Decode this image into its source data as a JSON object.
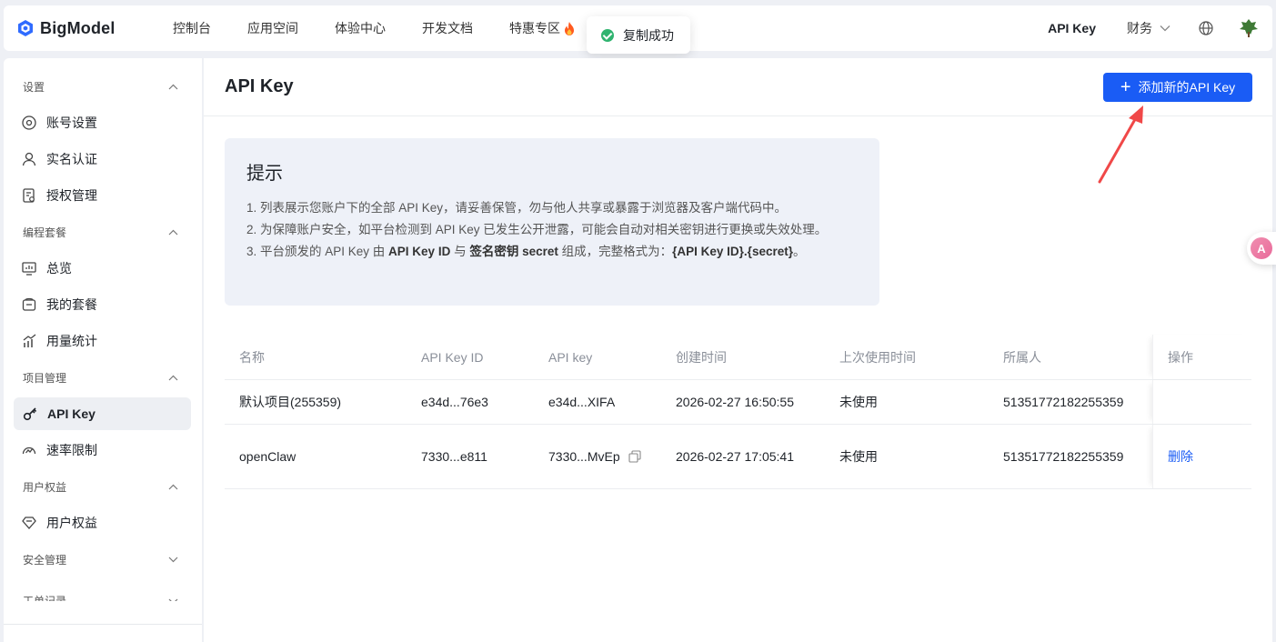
{
  "brand": {
    "name": "BigModel"
  },
  "topnav": {
    "items": [
      "控制台",
      "应用空间",
      "体验中心",
      "开发文档",
      "特惠专区"
    ],
    "apikey": "API Key",
    "finance": "财务"
  },
  "toast": {
    "text": "复制成功"
  },
  "sidebar": {
    "groups": [
      {
        "label": "设置",
        "items": [
          "账号设置",
          "实名认证",
          "授权管理"
        ]
      },
      {
        "label": "编程套餐",
        "items": [
          "总览",
          "我的套餐",
          "用量统计"
        ]
      },
      {
        "label": "项目管理",
        "items": [
          "API Key",
          "速率限制"
        ]
      },
      {
        "label": "用户权益",
        "items": [
          "用户权益"
        ]
      },
      {
        "label": "安全管理",
        "items": []
      },
      {
        "label": "工单记录",
        "items": []
      }
    ]
  },
  "main": {
    "title": "API Key",
    "add_button": "添加新的API Key"
  },
  "tip": {
    "title": "提示",
    "line1": "1. 列表展示您账户下的全部 API Key，请妥善保管，勿与他人共享或暴露于浏览器及客户端代码中。",
    "line2": "2. 为保障账户安全，如平台检测到 API Key 已发生公开泄露，可能会自动对相关密钥进行更换或失效处理。",
    "line3_a": "3. 平台颁发的 API Key 由 ",
    "line3_b": "API Key ID",
    "line3_c": " 与 ",
    "line3_d": "签名密钥 secret",
    "line3_e": " 组成，完整格式为：",
    "line3_f": "{API Key ID}.{secret}",
    "line3_g": "。"
  },
  "table": {
    "headers": [
      "名称",
      "API Key ID",
      "API key",
      "创建时间",
      "上次使用时间",
      "所属人",
      "操作"
    ],
    "rows": [
      {
        "name": "默认项目(255359)",
        "key_id": "e34d...76e3",
        "key": "e34d...XIFA",
        "created": "2026-02-27 16:50:55",
        "last_used": "未使用",
        "owner": "51351772182255359",
        "action": ""
      },
      {
        "name": "openClaw",
        "key_id": "7330...e811",
        "key": "7330...MvEp",
        "created": "2026-02-27 17:05:41",
        "last_used": "未使用",
        "owner": "51351772182255359",
        "action": "删除"
      }
    ]
  },
  "colors": {
    "primary": "#1a5cf5",
    "success": "#2fb36f",
    "arrow": "#f04848"
  }
}
